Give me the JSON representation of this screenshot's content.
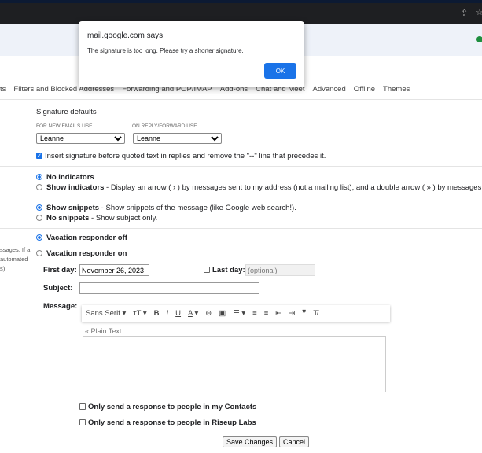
{
  "dialog": {
    "origin": "mail.google.com says",
    "message": "The signature is too long. Please try a shorter signature.",
    "ok": "OK"
  },
  "tabs": [
    "ts",
    "Filters and Blocked Addresses",
    "Forwarding and POP/IMAP",
    "Add-ons",
    "Chat and Meet",
    "Advanced",
    "Offline",
    "Themes"
  ],
  "signature": {
    "title": "Signature defaults",
    "new_label": "FOR NEW EMAILS USE",
    "reply_label": "ON REPLY/FORWARD USE",
    "new_value": "Leanne",
    "reply_value": "Leanne",
    "insert_label": "Insert signature before quoted text in replies and remove the \"--\" line that precedes it."
  },
  "indicators": {
    "no": "No indicators",
    "show": "Show indicators",
    "show_desc": " - Display an arrow ( › ) by messages sent to my address (not a mailing list), and a double arrow ( » ) by messages sent o"
  },
  "snippets": {
    "show": "Show snippets",
    "show_desc": " - Show snippets of the message (like Google web search!).",
    "no": "No snippets",
    "no_desc": " - Show subject only."
  },
  "vacation": {
    "left_text": [
      "ssages. If a",
      "automated",
      "s)"
    ],
    "off": "Vacation responder off",
    "on": "Vacation responder on",
    "first_day_label": "First day:",
    "first_day_value": "November 26, 2023",
    "last_day_label": "Last day:",
    "last_day_placeholder": "(optional)",
    "subject_label": "Subject:",
    "message_label": "Message:",
    "font": "Sans Serif",
    "plain_text": "« Plain Text",
    "contacts_only": "Only send a response to people in my Contacts",
    "org_only": "Only send a response to people in Riseup Labs"
  },
  "footer": {
    "save": "Save Changes",
    "cancel": "Cancel"
  }
}
